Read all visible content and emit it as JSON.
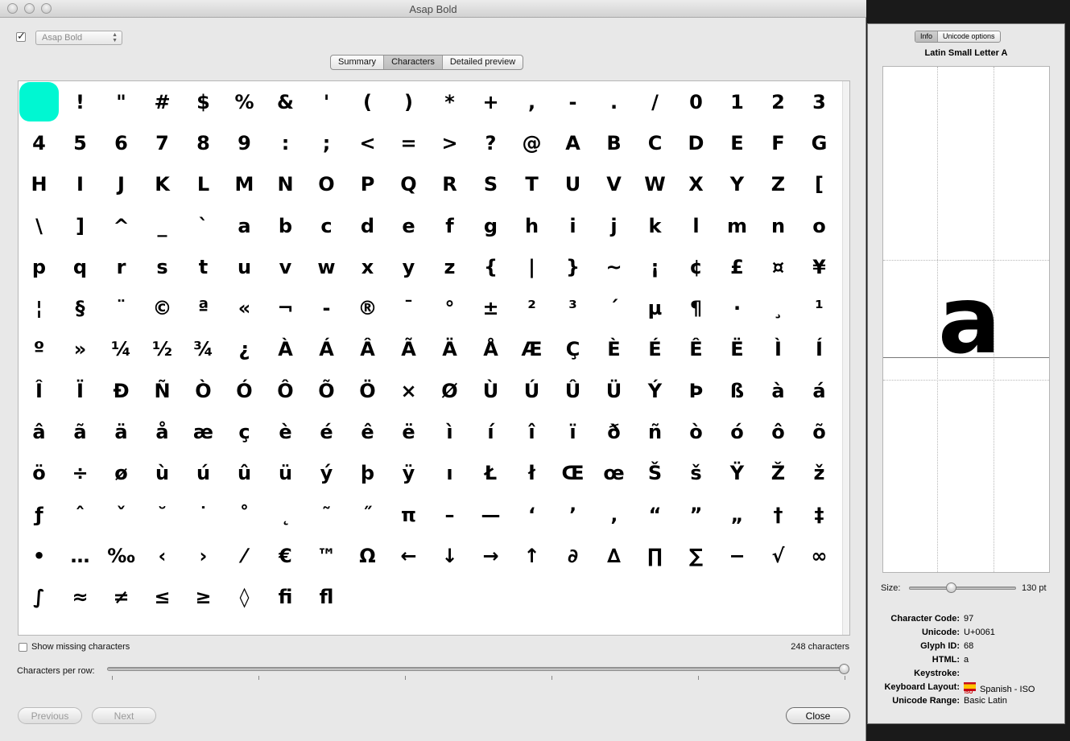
{
  "window": {
    "title": "Asap Bold"
  },
  "toolbar": {
    "font_enabled": true,
    "font_select_value": "Asap Bold"
  },
  "tabs": [
    {
      "label": "Summary",
      "active": false
    },
    {
      "label": "Characters",
      "active": true
    },
    {
      "label": "Detailed preview",
      "active": false
    }
  ],
  "glyph_grid": {
    "selected_index": 0,
    "accent_color": "#00f7d2",
    "glyphs": [
      " ",
      "!",
      "\"",
      "#",
      "$",
      "%",
      "&",
      "'",
      "(",
      ")",
      "*",
      "+",
      ",",
      "-",
      ".",
      "/",
      "0",
      "1",
      "2",
      "3",
      "4",
      "5",
      "6",
      "7",
      "8",
      "9",
      ":",
      ";",
      "<",
      "=",
      ">",
      "?",
      "@",
      "A",
      "B",
      "C",
      "D",
      "E",
      "F",
      "G",
      "H",
      "I",
      "J",
      "K",
      "L",
      "M",
      "N",
      "O",
      "P",
      "Q",
      "R",
      "S",
      "T",
      "U",
      "V",
      "W",
      "X",
      "Y",
      "Z",
      "[",
      "\\",
      "]",
      "^",
      "_",
      "`",
      "a",
      "b",
      "c",
      "d",
      "e",
      "f",
      "g",
      "h",
      "i",
      "j",
      "k",
      "l",
      "m",
      "n",
      "o",
      "p",
      "q",
      "r",
      "s",
      "t",
      "u",
      "v",
      "w",
      "x",
      "y",
      "z",
      "{",
      "|",
      "}",
      "~",
      "¡",
      "¢",
      "£",
      "¤",
      "¥",
      "¦",
      "§",
      "¨",
      "©",
      "ª",
      "«",
      "¬",
      "-",
      "®",
      "¯",
      "°",
      "±",
      "²",
      "³",
      "´",
      "µ",
      "¶",
      "·",
      "¸",
      "¹",
      "º",
      "»",
      "¼",
      "½",
      "¾",
      "¿",
      "À",
      "Á",
      "Â",
      "Ã",
      "Ä",
      "Å",
      "Æ",
      "Ç",
      "È",
      "É",
      "Ê",
      "Ë",
      "Ì",
      "Í",
      "Î",
      "Ï",
      "Ð",
      "Ñ",
      "Ò",
      "Ó",
      "Ô",
      "Õ",
      "Ö",
      "×",
      "Ø",
      "Ù",
      "Ú",
      "Û",
      "Ü",
      "Ý",
      "Þ",
      "ß",
      "à",
      "á",
      "â",
      "ã",
      "ä",
      "å",
      "æ",
      "ç",
      "è",
      "é",
      "ê",
      "ë",
      "ì",
      "í",
      "î",
      "ï",
      "ð",
      "ñ",
      "ò",
      "ó",
      "ô",
      "õ",
      "ö",
      "÷",
      "ø",
      "ù",
      "ú",
      "û",
      "ü",
      "ý",
      "þ",
      "ÿ",
      "ı",
      "Ł",
      "ł",
      "Œ",
      "œ",
      "Š",
      "š",
      "Ÿ",
      "Ž",
      "ž",
      "ƒ",
      "ˆ",
      "ˇ",
      "˘",
      "˙",
      "˚",
      "˛",
      "˜",
      "˝",
      "π",
      "–",
      "—",
      "‘",
      "’",
      "‚",
      "“",
      "”",
      "„",
      "†",
      "‡",
      "•",
      "…",
      "‰",
      "‹",
      "›",
      "⁄",
      "€",
      "™",
      "Ω",
      "←",
      "↓",
      "→",
      "↑",
      "∂",
      "∆",
      "∏",
      "∑",
      "−",
      "√",
      "∞",
      "∫",
      "≈",
      "≠",
      "≤",
      "≥",
      "◊",
      "ﬁ",
      "ﬂ"
    ]
  },
  "footer": {
    "show_missing_label": "Show missing characters",
    "show_missing_checked": false,
    "char_count": "248 characters",
    "per_row_label": "Characters per row:",
    "per_row_slider_level": 1.0,
    "previous_label": "Previous",
    "next_label": "Next",
    "close_label": "Close"
  },
  "panel": {
    "tabs": [
      {
        "label": "Info",
        "active": true
      },
      {
        "label": "Unicode options",
        "active": false
      }
    ],
    "char_name": "Latin Small Letter A",
    "preview_glyph": "a",
    "size_label": "Size:",
    "size_value": "130 pt",
    "size_slider_level": 0.38,
    "info": [
      {
        "key": "Character Code:",
        "value": "97"
      },
      {
        "key": "Unicode:",
        "value": "U+0061"
      },
      {
        "key": "Glyph ID:",
        "value": "68"
      },
      {
        "key": "HTML:",
        "value": "a"
      },
      {
        "key": "Keystroke:",
        "value": ""
      },
      {
        "key": "Keyboard Layout:",
        "value": "Spanish - ISO",
        "flag_icon": "spain-flag-icon",
        "flag_text": "ISO"
      },
      {
        "key": "Unicode Range:",
        "value": "Basic Latin"
      }
    ]
  }
}
